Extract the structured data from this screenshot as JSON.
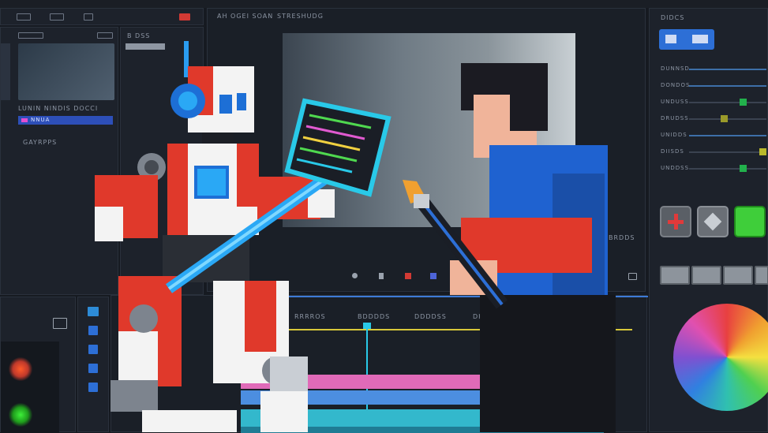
{
  "viewer": {
    "title_left": "AH OGEI SOAN",
    "title_right": "STRESHUDG"
  },
  "left_panel": {
    "section_label": "LUNIN NINDIS DOCCI",
    "highlight_item": "NNUA",
    "sub_label": "GAYRPPS",
    "right_tab_label": "B DSS"
  },
  "right_panel": {
    "header": "DIDCS",
    "slider_labels": [
      "DUNNSD",
      "DONDOS",
      "UNDUSS",
      "DRUDSS",
      "UNIDDS",
      "DIISDS",
      "UNDDSS"
    ],
    "slider_values": [
      0.05,
      0.0,
      0.72,
      0.45,
      0.0,
      1.0,
      0.72
    ],
    "slider_colors": [
      "#3d8bd6",
      "#3d8bd6",
      "#22b14c",
      "#9a9a2a",
      "#3d8bd6",
      "#b8b82a",
      "#22b14c"
    ]
  },
  "timeline": {
    "ruler_labels": [
      "RRRROS",
      "BDDDDS",
      "DDDDSS",
      "DHDDS"
    ],
    "side_label": "BRDDS"
  },
  "colors": {
    "accent_blue": "#2d6fd6",
    "robot_red": "#e0392b",
    "shirt_blue": "#1f62d0",
    "accent_cyan": "#29c9e8"
  }
}
